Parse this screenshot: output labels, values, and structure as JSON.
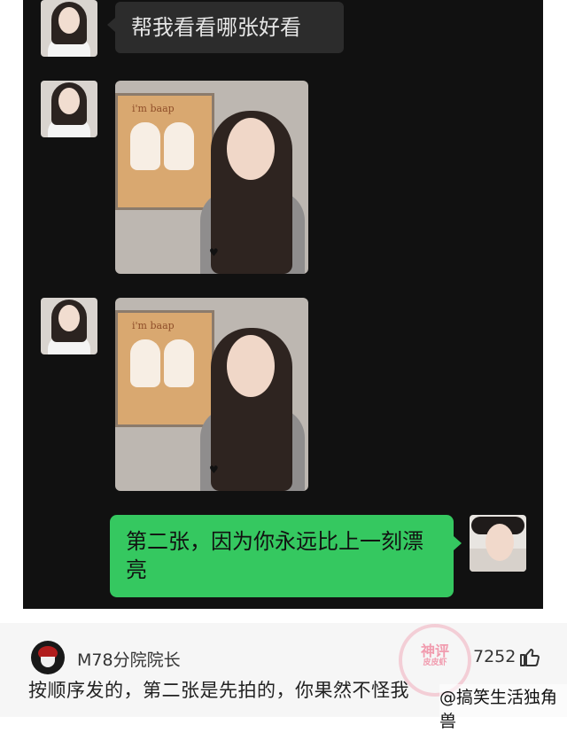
{
  "messages": [
    {
      "sender": "other",
      "type": "text",
      "text": "帮我看看哪张好看"
    },
    {
      "sender": "other",
      "type": "image",
      "poster_text": "i'm baap"
    },
    {
      "sender": "other",
      "type": "image",
      "poster_text": "i'm baap"
    },
    {
      "sender": "me",
      "type": "text",
      "text": "第二张，因为你永远比上一刻漂亮"
    }
  ],
  "comment": {
    "username": "M78分院院长",
    "like_count": "7252",
    "text": "按顺序发的，第二张是先拍的，你果然不怪我",
    "watermark": "神评",
    "watermark_subtext": "皮皮虾",
    "credit": "@搞笑生活独角兽"
  }
}
